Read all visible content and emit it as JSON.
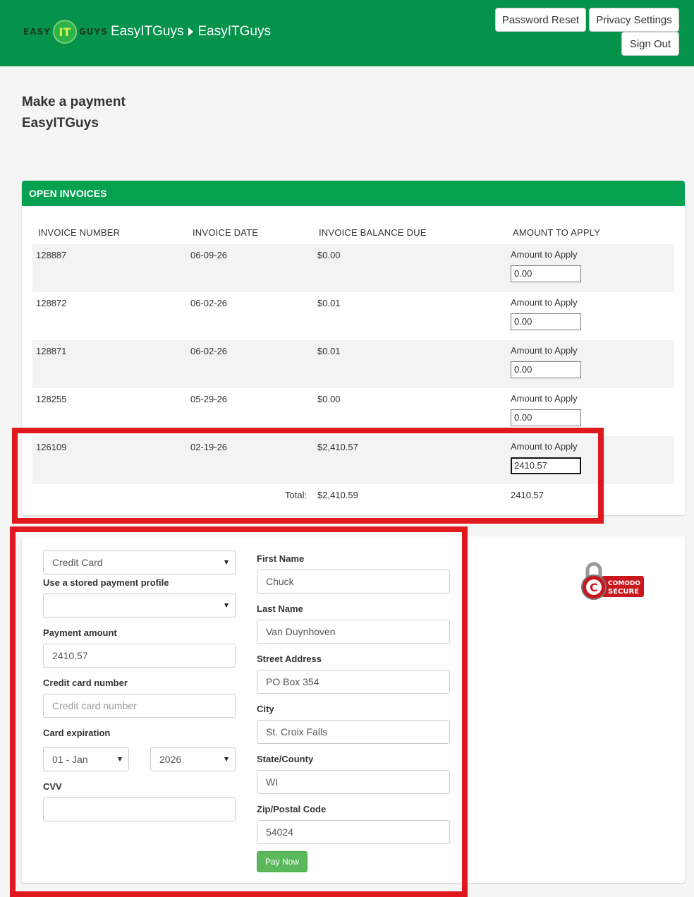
{
  "header": {
    "logo": {
      "left": "EASY",
      "middle": "IT",
      "right": "GUYS"
    },
    "breadcrumb": [
      "EasyITGuys",
      "EasyITGuys"
    ],
    "buttons": {
      "password_reset": "Password Reset",
      "privacy_settings": "Privacy Settings",
      "sign_out": "Sign Out"
    }
  },
  "page": {
    "title": "Make a payment",
    "subtitle": "EasyITGuys"
  },
  "invoices": {
    "panel_title": "OPEN INVOICES",
    "columns": [
      "INVOICE NUMBER",
      "INVOICE DATE",
      "INVOICE BALANCE DUE",
      "AMOUNT TO APPLY"
    ],
    "rows": [
      {
        "number": "128887",
        "date": "06-09-26",
        "balance": "$0.00",
        "apply_label": "Amount to Apply",
        "apply_value": "0.00"
      },
      {
        "number": "128872",
        "date": "06-02-26",
        "balance": "$0.01",
        "apply_label": "Amount to Apply",
        "apply_value": "0.00"
      },
      {
        "number": "128871",
        "date": "06-02-26",
        "balance": "$0.01",
        "apply_label": "Amount to Apply",
        "apply_value": "0.00"
      },
      {
        "number": "128255",
        "date": "05-29-26",
        "balance": "$0.00",
        "apply_label": "Amount to Apply",
        "apply_value": "0.00"
      },
      {
        "number": "126109",
        "date": "02-19-26",
        "balance": "$2,410.57",
        "apply_label": "Amount to Apply",
        "apply_value": "2410.57"
      }
    ],
    "total_label": "Total:",
    "total_balance": "$2,410.59",
    "total_apply": "2410.57"
  },
  "payment": {
    "method": "Credit Card",
    "stored_profile_label": "Use a stored payment profile",
    "stored_profile_value": "",
    "amount_label": "Payment amount",
    "amount_value": "2410.57",
    "cc_label": "Credit card number",
    "cc_placeholder": "Credit card number",
    "exp_label": "Card expiration",
    "exp_month": "01 - Jan",
    "exp_year": "2026",
    "cvv_label": "CVV",
    "cvv_value": "",
    "first_name_label": "First Name",
    "first_name": "Chuck",
    "last_name_label": "Last Name",
    "last_name": "Van Duynhoven",
    "street_label": "Street Address",
    "street": "PO Box 354",
    "city_label": "City",
    "city": "St. Croix Falls",
    "state_label": "State/County",
    "state": "WI",
    "zip_label": "Zip/Postal Code",
    "zip": "54024",
    "pay_button": "Pay Now"
  },
  "seal": {
    "line1": "COMODO",
    "line2": "SECURE",
    "letter": "C"
  },
  "colors": {
    "brand_green": "#05924a",
    "panel_green": "#05a050",
    "button_green": "#5cb85c",
    "highlight_red": "#e0191f"
  }
}
